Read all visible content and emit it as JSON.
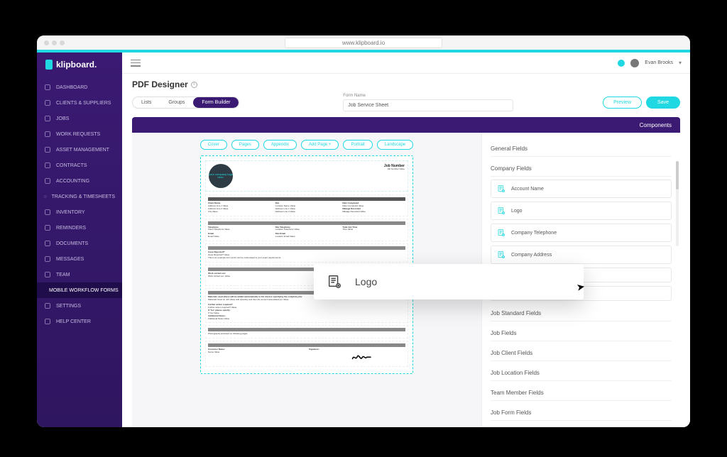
{
  "url": "www.klipboard.io",
  "brand": "klipboard.",
  "user": {
    "name": "Evan Brooks"
  },
  "sidebar": {
    "items": [
      {
        "label": "DASHBOARD",
        "icon": "dashboard-icon"
      },
      {
        "label": "CLIENTS & SUPPLIERS",
        "icon": "clients-icon"
      },
      {
        "label": "JOBS",
        "icon": "jobs-icon"
      },
      {
        "label": "WORK REQUESTS",
        "icon": "work-requests-icon"
      },
      {
        "label": "ASSET MANAGEMENT",
        "icon": "asset-icon"
      },
      {
        "label": "CONTRACTS",
        "icon": "contracts-icon"
      },
      {
        "label": "ACCOUNTING",
        "icon": "accounting-icon"
      },
      {
        "label": "TRACKING & TIMESHEETS",
        "icon": "tracking-icon"
      },
      {
        "label": "INVENTORY",
        "icon": "inventory-icon"
      },
      {
        "label": "REMINDERS",
        "icon": "reminders-icon"
      },
      {
        "label": "DOCUMENTS",
        "icon": "documents-icon"
      },
      {
        "label": "MESSAGES",
        "icon": "messages-icon"
      },
      {
        "label": "TEAM",
        "icon": "team-icon"
      },
      {
        "label": "MOBILE WORKFLOW FORMS",
        "icon": "forms-icon",
        "active": true
      },
      {
        "label": "SETTINGS",
        "icon": "settings-icon"
      },
      {
        "label": "HELP CENTER",
        "icon": "help-icon"
      }
    ]
  },
  "page": {
    "title": "PDF Designer",
    "tabs": [
      {
        "label": "Lists"
      },
      {
        "label": "Groups"
      },
      {
        "label": "Form Builder",
        "active": true
      }
    ],
    "form_name_label": "Form Name",
    "form_name_value": "Job Service Sheet",
    "preview_label": "Preview",
    "save_label": "Save"
  },
  "components_header": "Components",
  "toolbar": {
    "cover": "Cover",
    "pages": "Pages",
    "appendix": "Appendix",
    "add_page": "Add Page +",
    "portrait": "Portrait",
    "landscape": "Landscape"
  },
  "doc": {
    "logo_text": "your company logo here.",
    "job_number_label": "Job Number",
    "job_number_value": "Job Number Value",
    "client": {
      "h": "Client Name",
      "l1": "Address Line 1 Value",
      "l2": "Address Line 2 Value",
      "l3": "City Value"
    },
    "site": {
      "h": "Site",
      "l1": "Location Name Value",
      "l2": "Address Line 1 Value",
      "l3": "Address Line 2 Value"
    },
    "date": {
      "h": "Date Completed",
      "l1": "Date Completed Value",
      "l2": "Mileage Recorded",
      "l3": "Mileage Recorded Value"
    },
    "phone": {
      "h": "Telephone",
      "l1": "Client Telephone Value"
    },
    "sitephone": {
      "h": "Site Telephone",
      "l1": "Location Telephone Value"
    },
    "start": {
      "h": "Total Job Time",
      "l1": "Time Value"
    },
    "email": {
      "h": "Email",
      "l1": "Email Value"
    },
    "siteemail": {
      "h": "Site Email",
      "l1": "Location Email Value"
    },
    "issue": {
      "h": "Issue Reported?",
      "l1": "Issue Reported? Value",
      "note": "This is an example form and it can be customised to your exact requirements."
    },
    "work": {
      "h": "Work carried out:",
      "l1": "Work carried out: Value"
    },
    "materials": {
      "h": "Materials used (these will be added automatically to the invoice specifying the complete job):",
      "l1": "Materials Used on Job Value with Quantity and then the amount associated per Value"
    },
    "further": {
      "h": "Further action required?",
      "l1": "Further action required? Value",
      "l2": "If 'Yes' please specify:",
      "l3": "If Yes Value",
      "l4": "Additional Notes:",
      "l5": "Additional Notes Value"
    },
    "photos": "Photographs enclosed on following pages",
    "customer": {
      "h": "Customer Name:",
      "l1": "Name Value"
    },
    "signature_label": "Signature:"
  },
  "panel": {
    "sections": [
      {
        "title": "General Fields"
      },
      {
        "title": "Company Fields",
        "fields": [
          "Account Name",
          "Logo",
          "Company Telephone",
          "Company Address"
        ]
      },
      {
        "title": "Job Standard Fields"
      },
      {
        "title": "Job Fields"
      },
      {
        "title": "Job Client Fields"
      },
      {
        "title": "Job Location Fields"
      },
      {
        "title": "Team Member Fields"
      },
      {
        "title": "Job Form Fields"
      }
    ]
  },
  "dragging": {
    "label": "Logo"
  }
}
